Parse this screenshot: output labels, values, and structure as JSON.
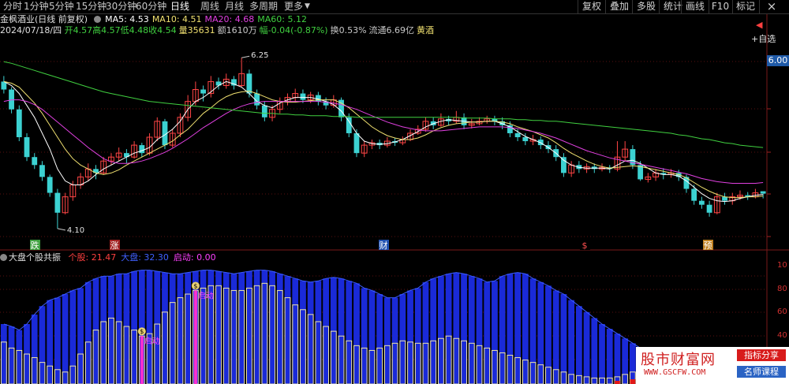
{
  "toolbar": {
    "left": [
      "分时",
      "1分钟",
      "5分钟",
      "15分钟",
      "30分钟",
      "60分钟",
      "日线",
      "周线",
      "月线",
      "多周期",
      "更多"
    ],
    "active_index": 6,
    "right": [
      "复权",
      "叠加",
      "多股",
      "统计",
      "画线",
      "F10",
      "标记"
    ],
    "close_glyph": "×"
  },
  "info": {
    "stock": "金枫酒业(日线 前复权)",
    "ma": [
      {
        "label": "MA5: 4.53",
        "color": "#ffffff"
      },
      {
        "label": "MA10: 4.51",
        "color": "#f0e070"
      },
      {
        "label": "MA20: 4.68",
        "color": "#e040e0"
      },
      {
        "label": "MA60: 5.12",
        "color": "#40d040"
      }
    ],
    "date": "2024/07/18/四",
    "stats": [
      {
        "label": "开4.57",
        "color": "#40d040"
      },
      {
        "label": "高4.57",
        "color": "#40d040"
      },
      {
        "label": "低4.48",
        "color": "#40d040"
      },
      {
        "label": "收4.54",
        "color": "#40d040"
      },
      {
        "label": "量35631",
        "color": "#f0e070"
      },
      {
        "label": "额1610万",
        "color": "#c8c8c8"
      },
      {
        "label": "幅-0.04(-0.87%)",
        "color": "#40d040"
      },
      {
        "label": "换0.53%",
        "color": "#c8c8c8"
      },
      {
        "label": "流通6.69亿",
        "color": "#c8c8c8"
      },
      {
        "label": "黄酒",
        "color": "#f0e070"
      }
    ]
  },
  "right_controls": {
    "add_watch": "+自选"
  },
  "price_tag": "6.00",
  "annotations": {
    "high": "6.25",
    "low": "4.10"
  },
  "event_markers": [
    {
      "text": "跌",
      "color": "#ffffff",
      "bg": "#40a040"
    },
    {
      "text": "涨",
      "color": "#ffffff",
      "bg": "#a02020"
    },
    {
      "text": "财",
      "color": "#ffffff",
      "bg": "#2050b0"
    },
    {
      "text": "$",
      "color": "#ff5050",
      "bg": "#000000"
    },
    {
      "text": "预",
      "color": "#ffffff",
      "bg": "#c08020"
    }
  ],
  "sub_indicator": {
    "title": "大盘个股共振",
    "items": [
      {
        "label": "个股: 21.47",
        "color": "#ff4040"
      },
      {
        "label": "大盘: 32.30",
        "color": "#4060ff"
      },
      {
        "label": "启动: 0.00",
        "color": "#ff40ff"
      }
    ],
    "start_label": "启动",
    "start_icon": "$"
  },
  "sub_axis": [
    "10",
    "80",
    "60",
    "40",
    "20"
  ],
  "watermark": {
    "main": "股市财富网",
    "url": "WWW.GSCFW.COM",
    "badge1": "指标分享",
    "badge2": "名师课程"
  },
  "chart_data": {
    "type": "candlestick",
    "bars": [
      [
        5.95,
        5.85,
        6.02,
        5.8
      ],
      [
        5.85,
        5.6,
        5.88,
        5.55
      ],
      [
        5.6,
        5.25,
        5.65,
        5.2
      ],
      [
        5.25,
        5.0,
        5.3,
        4.95
      ],
      [
        5.0,
        4.9,
        5.05,
        4.85
      ],
      [
        4.9,
        4.75,
        4.95,
        4.7
      ],
      [
        4.75,
        4.55,
        4.78,
        4.5
      ],
      [
        4.55,
        4.3,
        4.6,
        4.1
      ],
      [
        4.3,
        4.5,
        4.55,
        4.28
      ],
      [
        4.5,
        4.65,
        4.7,
        4.45
      ],
      [
        4.65,
        4.75,
        4.8,
        4.6
      ],
      [
        4.75,
        4.85,
        4.92,
        4.7
      ],
      [
        4.85,
        4.8,
        4.9,
        4.72
      ],
      [
        4.8,
        4.95,
        5.0,
        4.78
      ],
      [
        4.95,
        5.0,
        5.05,
        4.9
      ],
      [
        5.0,
        5.05,
        5.12,
        4.95
      ],
      [
        5.05,
        5.0,
        5.1,
        4.92
      ],
      [
        5.0,
        5.15,
        5.2,
        4.98
      ],
      [
        5.15,
        5.05,
        5.18,
        5.0
      ],
      [
        5.05,
        5.25,
        5.3,
        5.02
      ],
      [
        5.25,
        5.45,
        5.5,
        5.2
      ],
      [
        5.45,
        5.15,
        5.48,
        5.1
      ],
      [
        5.15,
        5.3,
        5.35,
        5.12
      ],
      [
        5.3,
        5.5,
        5.55,
        5.25
      ],
      [
        5.5,
        5.7,
        5.78,
        5.45
      ],
      [
        5.7,
        5.85,
        5.95,
        5.65
      ],
      [
        5.85,
        5.8,
        5.9,
        5.7
      ],
      [
        5.8,
        5.95,
        6.02,
        5.75
      ],
      [
        5.95,
        5.9,
        6.0,
        5.85
      ],
      [
        5.9,
        5.98,
        6.05,
        5.86
      ],
      [
        5.98,
        5.9,
        6.02,
        5.85
      ],
      [
        5.9,
        6.05,
        6.25,
        5.88
      ],
      [
        6.05,
        5.8,
        6.1,
        5.75
      ],
      [
        5.8,
        5.65,
        5.85,
        5.6
      ],
      [
        5.65,
        5.5,
        5.7,
        5.45
      ],
      [
        5.5,
        5.6,
        5.65,
        5.45
      ],
      [
        5.6,
        5.7,
        5.75,
        5.55
      ],
      [
        5.7,
        5.75,
        5.8,
        5.65
      ],
      [
        5.75,
        5.8,
        5.86,
        5.7
      ],
      [
        5.8,
        5.72,
        5.85,
        5.68
      ],
      [
        5.72,
        5.78,
        5.82,
        5.68
      ],
      [
        5.78,
        5.7,
        5.82,
        5.65
      ],
      [
        5.7,
        5.65,
        5.75,
        5.6
      ],
      [
        5.65,
        5.72,
        5.78,
        5.62
      ],
      [
        5.72,
        5.5,
        5.75,
        5.45
      ],
      [
        5.5,
        5.3,
        5.55,
        5.25
      ],
      [
        5.3,
        5.05,
        5.35,
        5.0
      ],
      [
        5.05,
        5.15,
        5.2,
        5.0
      ],
      [
        5.15,
        5.18,
        5.22,
        5.1
      ],
      [
        5.18,
        5.15,
        5.22,
        5.1
      ],
      [
        5.15,
        5.2,
        5.25,
        5.12
      ],
      [
        5.2,
        5.18,
        5.24,
        5.14
      ],
      [
        5.18,
        5.22,
        5.26,
        5.15
      ],
      [
        5.22,
        5.3,
        5.35,
        5.2
      ],
      [
        5.3,
        5.35,
        5.4,
        5.28
      ],
      [
        5.35,
        5.45,
        5.5,
        5.32
      ],
      [
        5.45,
        5.4,
        5.5,
        5.35
      ],
      [
        5.4,
        5.48,
        5.55,
        5.38
      ],
      [
        5.48,
        5.45,
        5.52,
        5.4
      ],
      [
        5.45,
        5.5,
        5.58,
        5.42
      ],
      [
        5.5,
        5.4,
        5.55,
        5.35
      ],
      [
        5.4,
        5.42,
        5.48,
        5.36
      ],
      [
        5.42,
        5.45,
        5.5,
        5.4
      ],
      [
        5.45,
        5.48,
        5.52,
        5.42
      ],
      [
        5.48,
        5.45,
        5.52,
        5.4
      ],
      [
        5.45,
        5.4,
        5.5,
        5.35
      ],
      [
        5.4,
        5.3,
        5.45,
        5.25
      ],
      [
        5.3,
        5.25,
        5.35,
        5.2
      ],
      [
        5.25,
        5.2,
        5.3,
        5.15
      ],
      [
        5.2,
        5.22,
        5.28,
        5.15
      ],
      [
        5.22,
        5.15,
        5.26,
        5.1
      ],
      [
        5.15,
        5.1,
        5.2,
        5.05
      ],
      [
        5.1,
        5.0,
        5.15,
        4.95
      ],
      [
        5.0,
        4.8,
        5.05,
        4.75
      ],
      [
        4.8,
        4.9,
        4.95,
        4.75
      ],
      [
        4.9,
        4.85,
        4.95,
        4.8
      ],
      [
        4.85,
        4.88,
        4.92,
        4.8
      ],
      [
        4.88,
        4.85,
        4.92,
        4.8
      ],
      [
        4.85,
        4.87,
        4.92,
        4.82
      ],
      [
        4.87,
        4.85,
        4.9,
        4.8
      ],
      [
        4.85,
        5.0,
        5.2,
        4.82
      ],
      [
        5.0,
        5.1,
        5.2,
        4.95
      ],
      [
        5.1,
        4.9,
        5.15,
        4.85
      ],
      [
        4.9,
        4.72,
        4.95,
        4.7
      ],
      [
        4.72,
        4.75,
        4.8,
        4.68
      ],
      [
        4.75,
        4.8,
        4.85,
        4.7
      ],
      [
        4.8,
        4.78,
        4.86,
        4.72
      ],
      [
        4.78,
        4.8,
        4.85,
        4.74
      ],
      [
        4.8,
        4.75,
        4.84,
        4.7
      ],
      [
        4.75,
        4.6,
        4.78,
        4.55
      ],
      [
        4.6,
        4.45,
        4.65,
        4.4
      ],
      [
        4.45,
        4.4,
        4.5,
        4.35
      ],
      [
        4.4,
        4.3,
        4.45,
        4.25
      ],
      [
        4.3,
        4.5,
        4.55,
        4.28
      ],
      [
        4.5,
        4.45,
        4.55,
        4.4
      ],
      [
        4.45,
        4.5,
        4.55,
        4.4
      ],
      [
        4.5,
        4.52,
        4.58,
        4.46
      ],
      [
        4.52,
        4.5,
        4.56,
        4.46
      ],
      [
        4.5,
        4.55,
        4.6,
        4.48
      ],
      [
        4.57,
        4.54,
        4.57,
        4.48
      ]
    ],
    "ma_series": [
      {
        "name": "MA5",
        "color": "#ffffff",
        "values": [
          5.95,
          5.9,
          5.8,
          5.65,
          5.5,
          5.3,
          5.1,
          4.85,
          4.7,
          4.65,
          4.65,
          4.7,
          4.78,
          4.85,
          4.9,
          4.95,
          5.0,
          5.05,
          5.08,
          5.12,
          5.22,
          5.28,
          5.35,
          5.45,
          5.6,
          5.7,
          5.75,
          5.82,
          5.9,
          5.95,
          5.92,
          5.88,
          5.8,
          5.7,
          5.65,
          5.62,
          5.68,
          5.72,
          5.75,
          5.75,
          5.75,
          5.73,
          5.7,
          5.66,
          5.58,
          5.45,
          5.3,
          5.2,
          5.17,
          5.16,
          5.17,
          5.19,
          5.22,
          5.27,
          5.32,
          5.38,
          5.42,
          5.45,
          5.47,
          5.46,
          5.45,
          5.44,
          5.44,
          5.45,
          5.45,
          5.42,
          5.38,
          5.32,
          5.26,
          5.22,
          5.18,
          5.12,
          5.05,
          4.96,
          4.9,
          4.87,
          4.86,
          4.86,
          4.86,
          4.85,
          4.9,
          4.95,
          4.96,
          4.92,
          4.86,
          4.8,
          4.78,
          4.78,
          4.76,
          4.7,
          4.62,
          4.54,
          4.48,
          4.45,
          4.44,
          4.45,
          4.48,
          4.5,
          4.52,
          4.53
        ]
      },
      {
        "name": "MA10",
        "color": "#f0e070",
        "values": [
          5.95,
          5.93,
          5.88,
          5.78,
          5.68,
          5.55,
          5.4,
          5.25,
          5.1,
          4.98,
          4.9,
          4.85,
          4.8,
          4.78,
          4.8,
          4.84,
          4.9,
          4.95,
          5.0,
          5.05,
          5.1,
          5.15,
          5.2,
          5.28,
          5.35,
          5.45,
          5.55,
          5.62,
          5.7,
          5.76,
          5.8,
          5.82,
          5.83,
          5.8,
          5.76,
          5.72,
          5.7,
          5.69,
          5.69,
          5.7,
          5.71,
          5.72,
          5.72,
          5.72,
          5.68,
          5.62,
          5.54,
          5.46,
          5.38,
          5.32,
          5.27,
          5.24,
          5.22,
          5.22,
          5.24,
          5.28,
          5.33,
          5.37,
          5.4,
          5.42,
          5.43,
          5.44,
          5.44,
          5.45,
          5.45,
          5.44,
          5.42,
          5.38,
          5.35,
          5.32,
          5.28,
          5.24,
          5.18,
          5.11,
          5.05,
          5.0,
          4.95,
          4.91,
          4.88,
          4.86,
          4.87,
          4.88,
          4.89,
          4.88,
          4.86,
          4.84,
          4.82,
          4.8,
          4.78,
          4.74,
          4.68,
          4.62,
          4.57,
          4.53,
          4.5,
          4.49,
          4.49,
          4.5,
          4.5,
          4.51
        ]
      },
      {
        "name": "MA20",
        "color": "#e040e0",
        "values": [
          5.7,
          5.72,
          5.72,
          5.7,
          5.66,
          5.6,
          5.52,
          5.44,
          5.36,
          5.28,
          5.2,
          5.12,
          5.05,
          4.98,
          4.94,
          4.92,
          4.92,
          4.93,
          4.95,
          4.98,
          5.02,
          5.06,
          5.11,
          5.17,
          5.23,
          5.3,
          5.37,
          5.43,
          5.49,
          5.55,
          5.6,
          5.64,
          5.67,
          5.69,
          5.7,
          5.7,
          5.7,
          5.7,
          5.7,
          5.7,
          5.7,
          5.7,
          5.69,
          5.68,
          5.66,
          5.63,
          5.6,
          5.56,
          5.52,
          5.48,
          5.44,
          5.41,
          5.38,
          5.36,
          5.34,
          5.33,
          5.33,
          5.33,
          5.34,
          5.35,
          5.36,
          5.37,
          5.38,
          5.38,
          5.38,
          5.38,
          5.37,
          5.36,
          5.34,
          5.32,
          5.3,
          5.27,
          5.24,
          5.2,
          5.16,
          5.12,
          5.08,
          5.05,
          5.02,
          4.99,
          4.97,
          4.95,
          4.93,
          4.91,
          4.89,
          4.87,
          4.85,
          4.83,
          4.81,
          4.79,
          4.76,
          4.73,
          4.71,
          4.69,
          4.68,
          4.67,
          4.67,
          4.67,
          4.67,
          4.68
        ]
      },
      {
        "name": "MA60",
        "color": "#40d040",
        "values": [
          6.2,
          6.18,
          6.15,
          6.12,
          6.09,
          6.06,
          6.03,
          6.0,
          5.97,
          5.94,
          5.91,
          5.88,
          5.85,
          5.82,
          5.8,
          5.78,
          5.76,
          5.74,
          5.72,
          5.7,
          5.69,
          5.68,
          5.67,
          5.66,
          5.65,
          5.64,
          5.63,
          5.62,
          5.61,
          5.6,
          5.59,
          5.58,
          5.57,
          5.56,
          5.55,
          5.55,
          5.54,
          5.54,
          5.53,
          5.53,
          5.52,
          5.52,
          5.52,
          5.51,
          5.51,
          5.51,
          5.5,
          5.5,
          5.5,
          5.5,
          5.5,
          5.5,
          5.5,
          5.5,
          5.5,
          5.5,
          5.5,
          5.5,
          5.5,
          5.5,
          5.49,
          5.49,
          5.49,
          5.49,
          5.48,
          5.48,
          5.48,
          5.47,
          5.47,
          5.46,
          5.46,
          5.45,
          5.45,
          5.44,
          5.43,
          5.42,
          5.41,
          5.4,
          5.39,
          5.38,
          5.37,
          5.36,
          5.35,
          5.34,
          5.33,
          5.32,
          5.31,
          5.3,
          5.28,
          5.27,
          5.25,
          5.23,
          5.22,
          5.2,
          5.18,
          5.17,
          5.15,
          5.14,
          5.13,
          5.12
        ]
      }
    ],
    "ylim": [
      4.0,
      6.5
    ],
    "marker_positions": [
      8,
      27,
      83,
      138,
      163
    ],
    "sub": {
      "ylim": [
        0,
        100
      ],
      "market": [
        50,
        48,
        45,
        50,
        58,
        65,
        70,
        72,
        75,
        78,
        80,
        85,
        88,
        90,
        90,
        92,
        92,
        94,
        95,
        95,
        94,
        93,
        92,
        92,
        93,
        94,
        95,
        95,
        94,
        93,
        92,
        93,
        94,
        95,
        95,
        94,
        92,
        90,
        88,
        86,
        85,
        86,
        88,
        89,
        88,
        86,
        84,
        80,
        78,
        75,
        72,
        72,
        75,
        78,
        80,
        85,
        88,
        90,
        92,
        93,
        92,
        90,
        88,
        85,
        86,
        90,
        92,
        93,
        92,
        88,
        85,
        82,
        78,
        75,
        70,
        65,
        60,
        55,
        50,
        46,
        42,
        38,
        34,
        30,
        26,
        24,
        22,
        20,
        18,
        16,
        14,
        12,
        10,
        9,
        8,
        7,
        6,
        6,
        5,
        5
      ],
      "stock": [
        35,
        30,
        28,
        25,
        22,
        18,
        15,
        12,
        10,
        15,
        25,
        35,
        45,
        52,
        55,
        52,
        48,
        45,
        40,
        42,
        50,
        60,
        68,
        72,
        75,
        78,
        80,
        82,
        82,
        80,
        78,
        78,
        80,
        82,
        84,
        82,
        78,
        72,
        66,
        62,
        58,
        52,
        48,
        44,
        40,
        36,
        32,
        30,
        28,
        30,
        32,
        34,
        36,
        35,
        34,
        34,
        36,
        38,
        40,
        38,
        36,
        34,
        32,
        30,
        28,
        26,
        24,
        22,
        20,
        18,
        16,
        14,
        12,
        10,
        8,
        7,
        6,
        5,
        5,
        5,
        6,
        8,
        10,
        12,
        14,
        15,
        14,
        12,
        10,
        8,
        7,
        6,
        5,
        5,
        5,
        4,
        4,
        4,
        3,
        3
      ],
      "start_bars": [
        18,
        25,
        96
      ],
      "red_bars": [
        80,
        82,
        83,
        84,
        85,
        86,
        87,
        88,
        89,
        90,
        91,
        92,
        93,
        94
      ]
    }
  }
}
